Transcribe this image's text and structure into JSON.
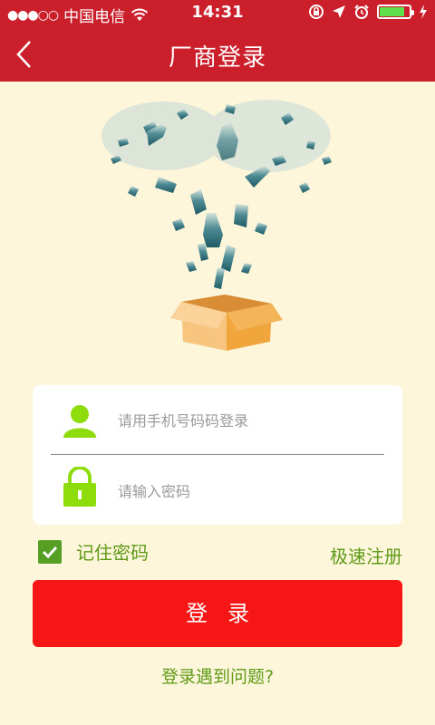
{
  "status_bar": {
    "signal": "●●●○○",
    "carrier": "中国电信",
    "time": "14:31",
    "battery_level": 0.85,
    "icons": [
      "wifi-icon",
      "rotation-lock-icon",
      "location-arrow-icon",
      "alarm-clock-icon",
      "battery-icon",
      "charging-bolt-icon"
    ]
  },
  "nav": {
    "title": "厂商登录",
    "back_icon": "chevron-left-icon"
  },
  "hero": {
    "description_icon": "box-with-bottles-illustration"
  },
  "form": {
    "phone": {
      "placeholder": "请用手机号码码登录",
      "value": "",
      "icon": "user-icon"
    },
    "password": {
      "placeholder": "请输入密码",
      "value": "",
      "icon": "lock-icon"
    }
  },
  "remember": {
    "label": "记住密码",
    "checked": true
  },
  "register_label": "极速注册",
  "login_label": "登录",
  "help_label": "登录遇到问题?",
  "colors": {
    "header": "#cc1f2c",
    "background": "#fef6da",
    "accent_green": "#5e9a17",
    "icon_green": "#8fdc0d",
    "button_red": "#f71616"
  }
}
